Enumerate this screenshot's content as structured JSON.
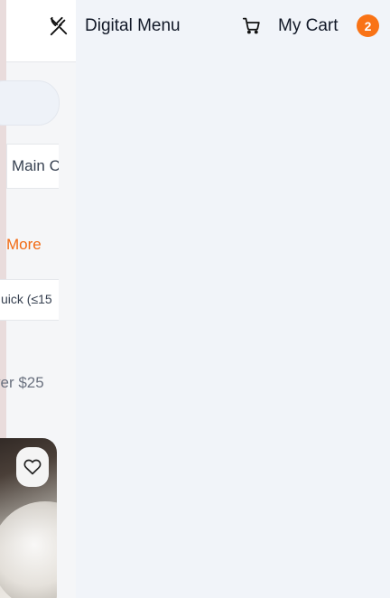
{
  "header": {
    "brand": "Digital Menu",
    "cart_label": "My Cart",
    "cart_count": "2",
    "logo_icon": "utensils-crossed-icon",
    "cart_icon": "shopping-cart-icon"
  },
  "drawer": {
    "category_chip": "Main C",
    "more_link": "More",
    "filter_chip": "uick (≤15",
    "price_text": "ver $25",
    "favorite_icon": "heart-icon"
  },
  "colors": {
    "accent": "#f97316",
    "background": "#f1f4f9"
  }
}
